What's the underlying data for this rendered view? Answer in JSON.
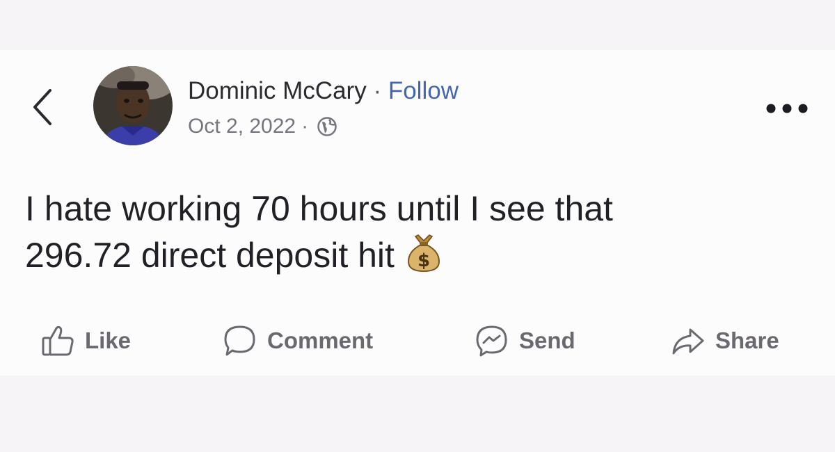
{
  "post": {
    "author_name": "Dominic McCary",
    "separator": "·",
    "follow_label": "Follow",
    "date": "Oct 2, 2022",
    "date_separator": "·",
    "text_line1": "I hate working 70 hours until I see that",
    "text_line2": "296.72 direct deposit hit",
    "emoji": "money-bag-icon"
  },
  "actions": {
    "like_label": "Like",
    "comment_label": "Comment",
    "send_label": "Send",
    "share_label": "Share"
  },
  "colors": {
    "follow": "#4267b2",
    "text": "#221f27",
    "muted": "#6b6870"
  }
}
